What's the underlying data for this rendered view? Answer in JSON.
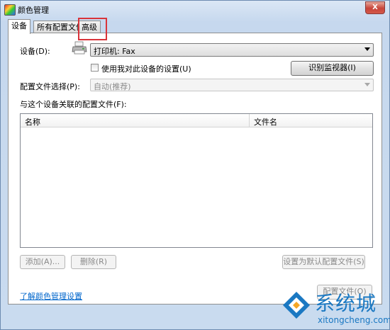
{
  "window": {
    "title": "颜色管理",
    "close_label": "X"
  },
  "tabs": [
    {
      "label": "设备",
      "active": true
    },
    {
      "label": "所有配置文件",
      "active": false
    },
    {
      "label": "高级",
      "active": false
    }
  ],
  "device": {
    "label": "设备(D):",
    "selected": "打印机: Fax",
    "use_my_settings_label": "使用我对此设备的设置(U)",
    "use_my_settings_checked": false,
    "identify_monitors_button": "识别监视器(I)"
  },
  "profile_selection": {
    "label": "配置文件选择(P):",
    "value": "自动(推荐)"
  },
  "associated_profiles": {
    "label": "与这个设备关联的配置文件(F):",
    "columns": [
      "名称",
      "文件名"
    ],
    "rows": []
  },
  "buttons": {
    "add": "添加(A)...",
    "remove": "删除(R)",
    "set_default": "设置为默认配置文件(S)",
    "profiles": "配置文件(O)"
  },
  "footer": {
    "learn_more_link": "了解颜色管理设置"
  },
  "watermark": {
    "text": "系统城",
    "subtext": "xitongcheng.com"
  },
  "colors": {
    "highlight": "#d9343a",
    "watermark": "#1a78c2",
    "link": "#0066cc"
  }
}
